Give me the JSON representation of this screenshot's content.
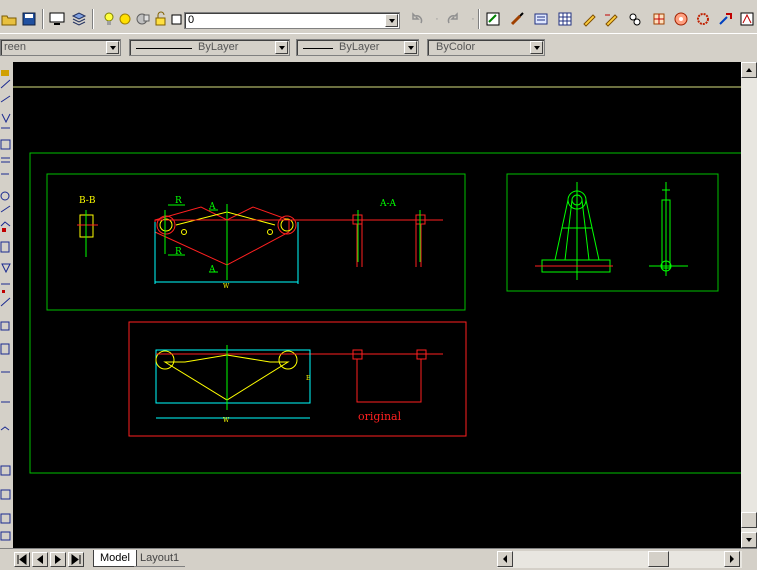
{
  "toolbar_top": {
    "layer_combo_value": "0"
  },
  "properties_bar": {
    "color_combo_value": "reen",
    "linetype_combo_value": "ByLayer",
    "lineweight_combo_value": "ByLayer",
    "plotstyle_combo_value": "ByColor"
  },
  "drawing": {
    "label_bb": "B-B",
    "label_aa": "A-A",
    "label_a_top": "A",
    "label_a_bottom": "A",
    "label_r_top": "R",
    "label_r_bottom": "R",
    "label_dim_w1": "W",
    "label_dim_w2": "W",
    "label_dim_h2": "E",
    "label_original": "original"
  },
  "tabs": [
    {
      "label": "Model",
      "active": true
    },
    {
      "label": "Layout1",
      "active": false
    }
  ],
  "colors": {
    "canvas": "#000000",
    "green": "#00ff00",
    "red": "#ff0000",
    "yellow": "#ffff00",
    "cyan": "#00ffff",
    "ui_grey": "#d4d0c8"
  }
}
